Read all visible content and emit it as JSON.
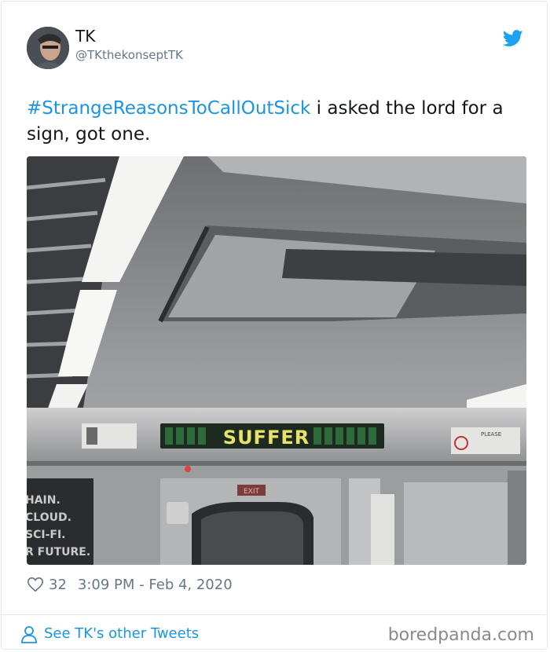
{
  "tweet": {
    "user_name": "TK",
    "user_handle": "@TKthekonseptTK",
    "hashtag": "#StrangeReasonsToCallOutSick",
    "text": " i asked the lord for a sign, got one.",
    "likes": "32",
    "timestamp": "3:09 PM - Feb 4, 2020"
  },
  "photo": {
    "sign_text": "SUFFER",
    "poster_lines": [
      "HAIN.",
      "CLOUD.",
      "SCI-FI.",
      "R FUTURE."
    ],
    "exit_text": "EXIT",
    "please_text": "PLEASE"
  },
  "footer": {
    "other_tweets_label": "See TK's other Tweets",
    "watermark": "boredpanda.com"
  },
  "icons": {
    "brand": "twitter-bird-icon",
    "like": "heart-icon",
    "profile": "person-icon"
  },
  "colors": {
    "link": "#1b95e0",
    "muted": "#657786",
    "sign_led": "#e8e26a"
  }
}
